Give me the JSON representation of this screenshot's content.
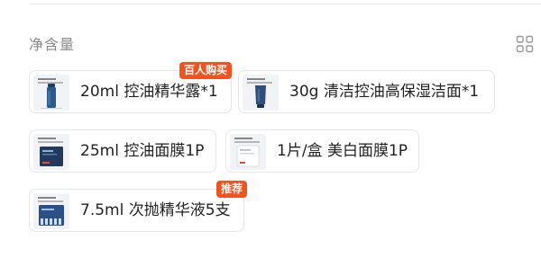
{
  "section": {
    "title": "净含量",
    "layout_toggle_icon": "grid-view-icon"
  },
  "options": [
    {
      "label": "20ml 控油精华露*1",
      "badge": "百人购买",
      "product_icon": "serum-bottle-thumbnail"
    },
    {
      "label": "30g 清洁控油高保湿洁面*1",
      "badge": "",
      "product_icon": "cleanser-tube-thumbnail"
    },
    {
      "label": "25ml 控油面膜1P",
      "badge": "",
      "product_icon": "dark-mask-box-thumbnail"
    },
    {
      "label": "1片/盒 美白面膜1P",
      "badge": "",
      "product_icon": "white-mask-box-thumbnail"
    },
    {
      "label": "7.5ml 次抛精华液5支",
      "badge": "推荐",
      "product_icon": "vials-box-thumbnail"
    }
  ],
  "colors": {
    "badge": "#f2521f",
    "border": "#e6e6e6",
    "title": "#8a8a8a",
    "text": "#222222"
  }
}
